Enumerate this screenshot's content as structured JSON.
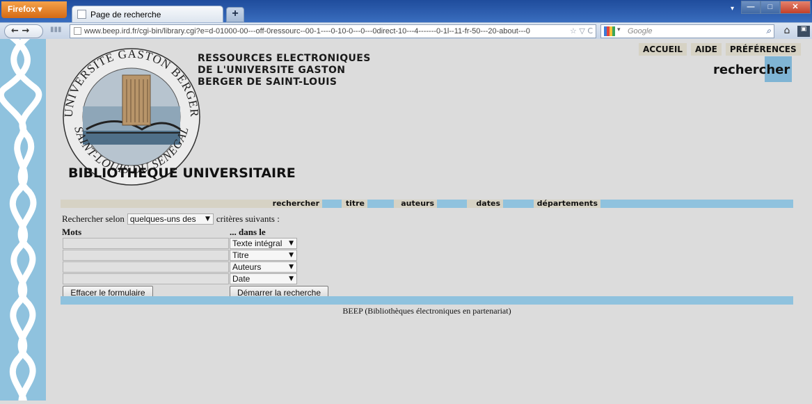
{
  "browser": {
    "menu_label": "Firefox ▾",
    "tab_title": "Page de recherche",
    "new_tab": "+",
    "url": "www.beep.ird.fr/cgi-bin/library.cgi?e=d-01000-00---off-0ressourc--00-1----0-10-0---0---0direct-10---4-------0-1l--11-fr-50---20-about---0",
    "url_controls": "☆ ▽ C",
    "search_placeholder": "Google",
    "back_forward": "←  →",
    "tab_menu": "▾",
    "window_controls": {
      "minimize": "—",
      "maximize": "□",
      "close": "✕"
    }
  },
  "header": {
    "title_lines": [
      "RESSOURCES ELECTRONIQUES",
      "DE L'UNIVERSITE GASTON",
      "BERGER DE SAINT-LOUIS"
    ],
    "subtitle": "BIBLIOTHEQUE UNIVERSITAIRE",
    "logo_text_top": "UNIVERSITE GASTON BERGER",
    "logo_text_bottom": "SAINT-LOUIS DU SENEGAL",
    "page_label": "rechercher"
  },
  "topnav": [
    "ACCUEIL",
    "AIDE",
    "PRÉFÉRENCES"
  ],
  "navbar": [
    "rechercher",
    "titre",
    "auteurs",
    "dates",
    "départements"
  ],
  "form": {
    "intro_before": "Rechercher selon",
    "mode_selected": "quelques-uns des",
    "intro_after": "critères suivants :",
    "col_words": "Mots",
    "col_field": "... dans le champ",
    "rows": [
      {
        "value": "",
        "field": "Texte intégral"
      },
      {
        "value": "",
        "field": "Titre"
      },
      {
        "value": "",
        "field": "Auteurs"
      },
      {
        "value": "",
        "field": "Date"
      }
    ],
    "clear_label": "Effacer le formulaire",
    "search_label": "Démarrer la recherche"
  },
  "footer": "BEEP (Bibliothèques électroniques en partenariat)",
  "colors": {
    "accent_blue": "#8fc2de",
    "nav_beige": "#d6d2c4",
    "page_bg": "#dcdcdc"
  }
}
